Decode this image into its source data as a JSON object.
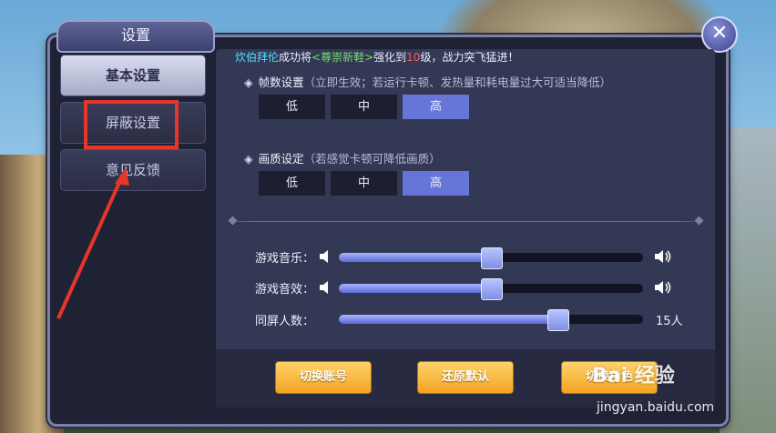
{
  "window": {
    "title": "设置",
    "close_symbol": "✕"
  },
  "sidebar": {
    "items": [
      {
        "label": "基本设置",
        "active": true
      },
      {
        "label": "屏蔽设置",
        "active": false,
        "highlighted": true
      },
      {
        "label": "意见反馈",
        "active": false
      }
    ]
  },
  "ticker": {
    "player": "炊伯拜伦",
    "text1": "成功将",
    "item": "<尊崇新鞋>",
    "text2": "强化到",
    "level": "10",
    "text3": "级，战力突飞猛进！"
  },
  "frame_rate": {
    "title": "帧数设置",
    "hint": "（立即生效；若运行卡顿、发热量和耗电量过大可适当降低）",
    "options": [
      "低",
      "中",
      "高"
    ],
    "selected": "高"
  },
  "quality": {
    "title": "画质设定",
    "hint": "（若感觉卡顿可降低画质）",
    "options": [
      "低",
      "中",
      "高"
    ],
    "selected": "高"
  },
  "sliders": {
    "music": {
      "label": "游戏音乐：",
      "value_fraction": 0.5
    },
    "effects": {
      "label": "游戏音效：",
      "value_fraction": 0.5
    },
    "players": {
      "label": "同屏人数：",
      "value_fraction": 0.72,
      "value_text": "15人"
    }
  },
  "buttons": {
    "switch_account": "切换账号",
    "restore_default": "还原默认",
    "third": "切换角色"
  },
  "watermark": {
    "text": "Bai 经验",
    "url": "jingyan.baidu.com"
  },
  "colors": {
    "accent": "#6676d6",
    "highlight_box": "#e8352a",
    "button_gold": "#f2a323",
    "player_name": "#57e0ff",
    "item_name": "#6fe16a",
    "level_num": "#ff5b5b"
  }
}
